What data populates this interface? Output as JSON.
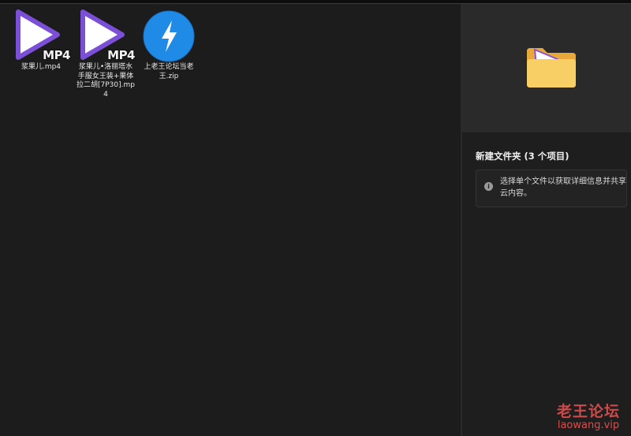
{
  "files": [
    {
      "name": "浆果儿.mp4",
      "badge": "MP4",
      "icon": "mp4-video-icon"
    },
    {
      "name": "浆果儿•洛丽塔水手服女王装+果体拉二胡[7P30].mp4",
      "badge": "MP4",
      "icon": "mp4-video-icon"
    },
    {
      "name": "上老王论坛当老王.zip",
      "icon": "zip-archive-icon"
    }
  ],
  "details": {
    "title": "新建文件夹 (3 个项目)",
    "info": "选择单个文件以获取详细信息并共享云内容。",
    "preview_icon": "folder-icon"
  },
  "watermark": {
    "cn": "老王论坛",
    "en": "laowang.vip"
  },
  "colors": {
    "play_purple": "#7b4fd6",
    "zip_blue": "#1f8be6",
    "folder_yellow": "#f6c85a"
  }
}
